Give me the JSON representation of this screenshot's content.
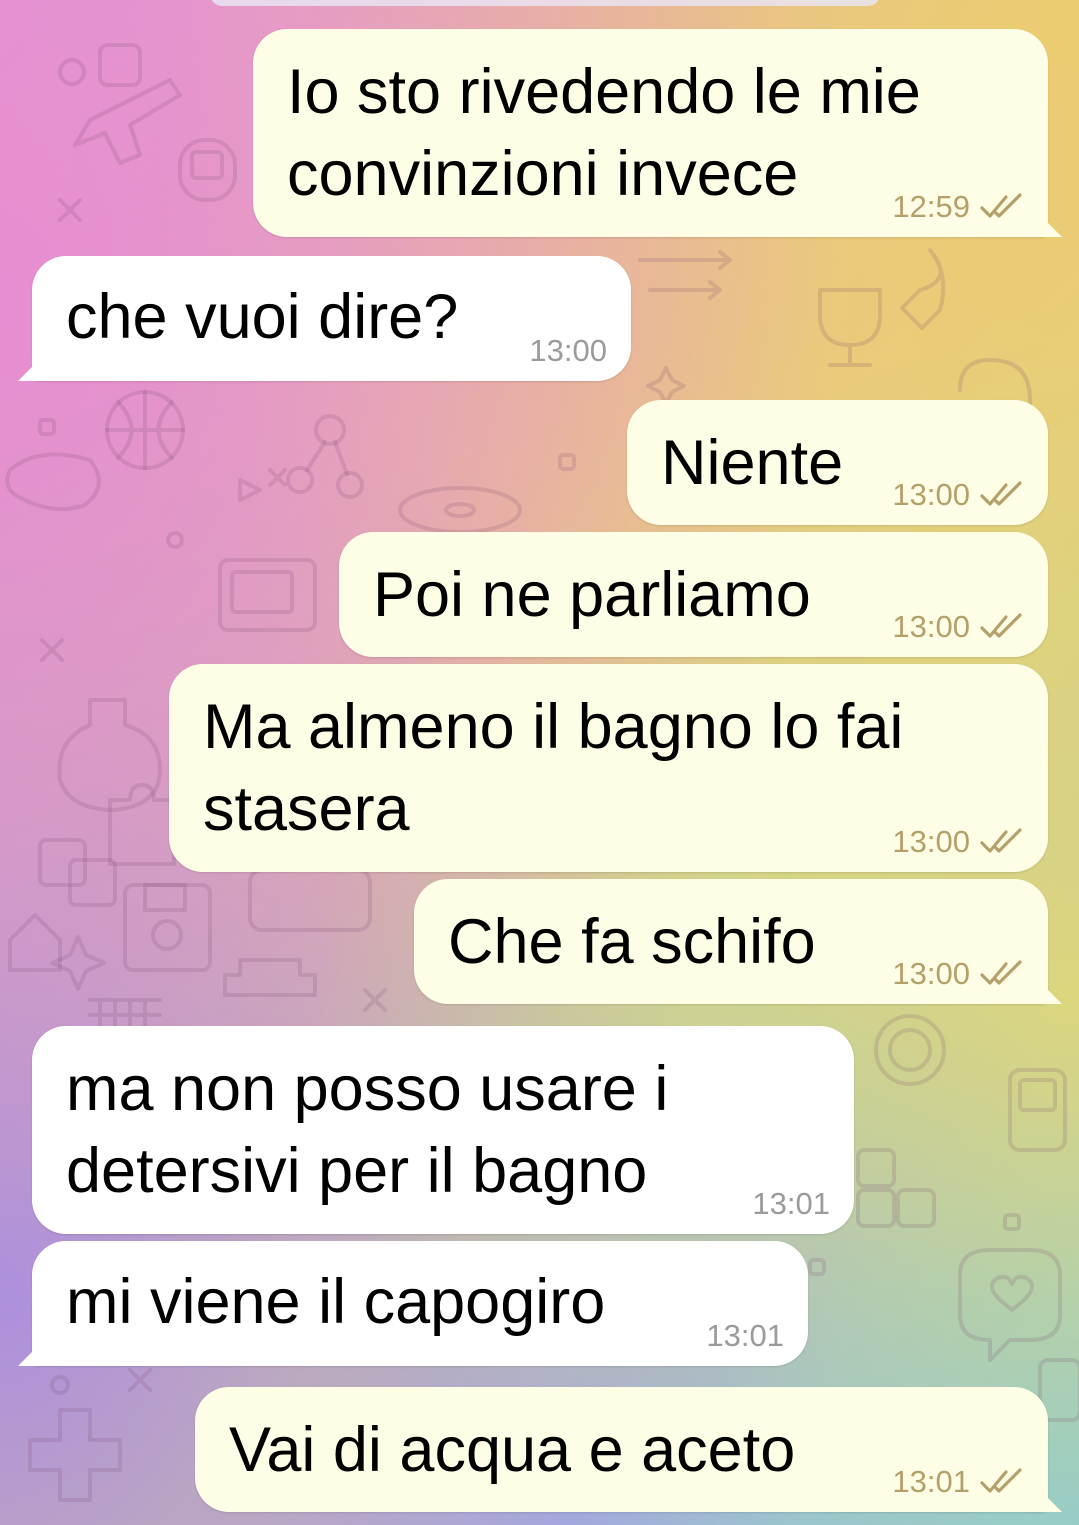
{
  "chat": {
    "messages": [
      {
        "dir": "out",
        "text": "Io sto rivedendo le mie\nconvinzioni invece",
        "time": "12:59",
        "status": "read-checkmarks-icon"
      },
      {
        "dir": "in",
        "text": "che vuoi dire?",
        "time": "13:00"
      },
      {
        "dir": "out",
        "text": "Niente",
        "time": "13:00",
        "status": "read-checkmarks-icon"
      },
      {
        "dir": "out",
        "text": "Poi ne parliamo",
        "time": "13:00",
        "status": "read-checkmarks-icon"
      },
      {
        "dir": "out",
        "text": "Ma almeno il bagno lo fai\nstasera",
        "time": "13:00",
        "status": "read-checkmarks-icon"
      },
      {
        "dir": "out",
        "text": "Che fa schifo",
        "time": "13:00",
        "status": "read-checkmarks-icon"
      },
      {
        "dir": "in",
        "text": "ma non posso usare i\ndetersivi per il bagno",
        "time": "13:01"
      },
      {
        "dir": "in",
        "text": "mi viene il capogiro",
        "time": "13:01"
      },
      {
        "dir": "out",
        "text": "Vai di acqua e aceto",
        "time": "13:01",
        "status": "read-checkmarks-icon"
      }
    ]
  },
  "colors": {
    "outgoing_bubble": "#fefee6",
    "incoming_bubble": "#ffffff",
    "outgoing_meta": "#b6a06a",
    "incoming_meta": "#9b9b9b"
  }
}
